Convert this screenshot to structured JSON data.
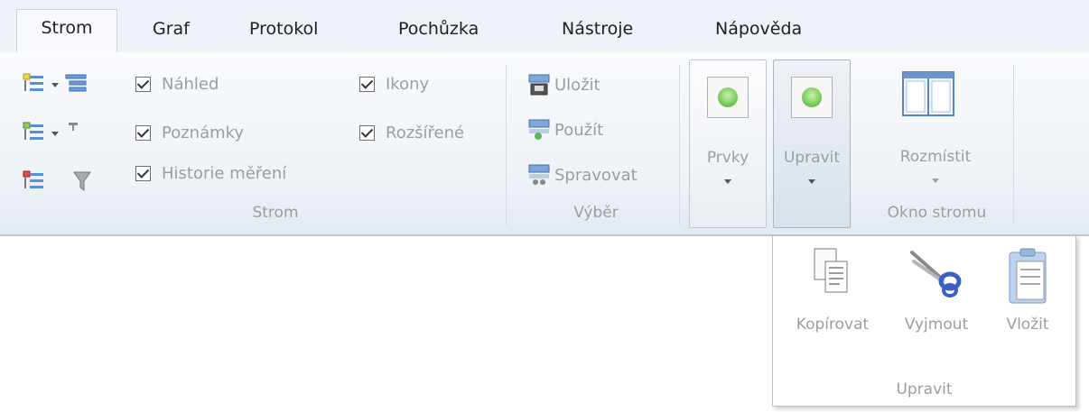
{
  "tabs": [
    "Strom",
    "Graf",
    "Protokol",
    "Pochůzka",
    "Nástroje",
    "Nápověda"
  ],
  "strom_group": {
    "label": "Strom",
    "checkboxes": [
      {
        "label": "Náhled",
        "checked": true
      },
      {
        "label": "Poznámky",
        "checked": true
      },
      {
        "label": "Historie měření",
        "checked": true
      },
      {
        "label": "Ikony",
        "checked": true
      },
      {
        "label": "Rozšířené",
        "checked": true
      }
    ]
  },
  "vyber_group": {
    "label": "Výběr",
    "items": [
      "Uložit",
      "Použít",
      "Spravovat"
    ]
  },
  "okno_group": {
    "label": "Okno stromu",
    "prvky_label": "Prvky",
    "upravit_label": "Upravit",
    "rozmistit_label": "Rozmístit"
  },
  "dropdown": {
    "label": "Upravit",
    "buttons": [
      "Kopírovat",
      "Vyjmout",
      "Vložit"
    ]
  },
  "colors": {
    "accent_green": "#7fcf5f",
    "disabled_text": "#9a9ea4",
    "tab_bar_bg": "#eef3fa"
  }
}
